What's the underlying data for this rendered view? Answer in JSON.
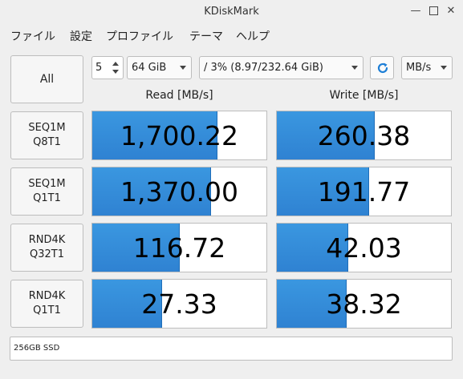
{
  "window": {
    "title": "KDiskMark"
  },
  "menu": [
    "ファイル",
    "設定",
    "プロファイル",
    "テーマ",
    "ヘルプ"
  ],
  "toolbar": {
    "all_label": "All",
    "runs": "5",
    "size": "64 GiB",
    "drive": "/ 3% (8.97/232.64 GiB)",
    "unit": "MB/s"
  },
  "headers": {
    "read": "Read [MB/s]",
    "write": "Write [MB/s]"
  },
  "tests": [
    {
      "line1": "SEQ1M",
      "line2": "Q8T1",
      "read": "1,700.22",
      "write": "260.38",
      "read_fill": 0.72,
      "write_fill": 0.56
    },
    {
      "line1": "SEQ1M",
      "line2": "Q1T1",
      "read": "1,370.00",
      "write": "191.77",
      "read_fill": 0.68,
      "write_fill": 0.53
    },
    {
      "line1": "RND4K",
      "line2": "Q32T1",
      "read": "116.72",
      "write": "42.03",
      "read_fill": 0.5,
      "write_fill": 0.41
    },
    {
      "line1": "RND4K",
      "line2": "Q1T1",
      "read": "27.33",
      "write": "38.32",
      "read_fill": 0.4,
      "write_fill": 0.4
    }
  ],
  "status": "256GB SSD"
}
